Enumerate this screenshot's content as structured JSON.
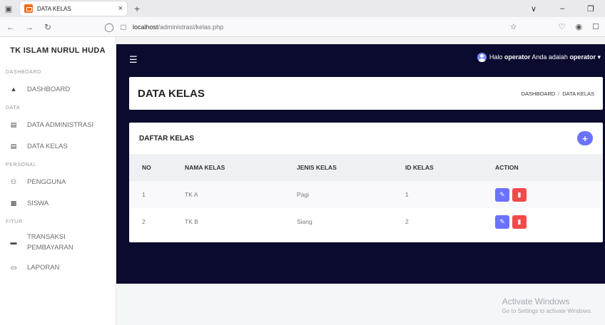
{
  "browser": {
    "tab_title": "DATA KELAS",
    "tab_close": "×",
    "new_tab": "+",
    "url_host": "localhost",
    "url_path": "/administrasi/kelas.php"
  },
  "sidebar": {
    "brand": "TK ISLAM NURUL HUDA",
    "sections": {
      "dashboard": "DASHBOARD",
      "data": "DATA",
      "personal": "PERSONAL",
      "fitur": "FITUR"
    },
    "items": {
      "dashboard": "DASHBOARD",
      "data_administrasi": "DATA ADMINISTRASI",
      "data_kelas": "DATA KELAS",
      "pengguna": "PENGGUNA",
      "siswa": "SISWA",
      "transaksi_1": "TRANSAKSI",
      "transaksi_2": "PEMBAYARAN",
      "laporan": "LAPORAN"
    }
  },
  "topbar": {
    "greeting_prefix": "Halo ",
    "user": "operator",
    "greeting_mid": " Anda adalah ",
    "role": "operator",
    "caret": "▾"
  },
  "header": {
    "title": "DATA KELAS",
    "breadcrumb_home": "DASHBOARD",
    "breadcrumb_sep": "/",
    "breadcrumb_current": "DATA KELAS"
  },
  "card": {
    "title": "DAFTAR KELAS",
    "add_label": "+"
  },
  "table": {
    "headers": {
      "no": "NO",
      "nama": "NAMA KELAS",
      "jenis": "JENIS KELAS",
      "id": "ID KELAS",
      "action": "ACTION"
    },
    "rows": [
      {
        "no": "1",
        "nama": "TK A",
        "jenis": "Pagi",
        "id": "1"
      },
      {
        "no": "2",
        "nama": "TK B",
        "jenis": "Siang",
        "id": "2"
      }
    ]
  },
  "watermark": {
    "line1": "Activate Windows",
    "line2": "Go to Settings to activate Windows."
  },
  "colors": {
    "topbar_bg": "#0b0b2f",
    "accent": "#6b72ff",
    "danger": "#f24a4a"
  }
}
